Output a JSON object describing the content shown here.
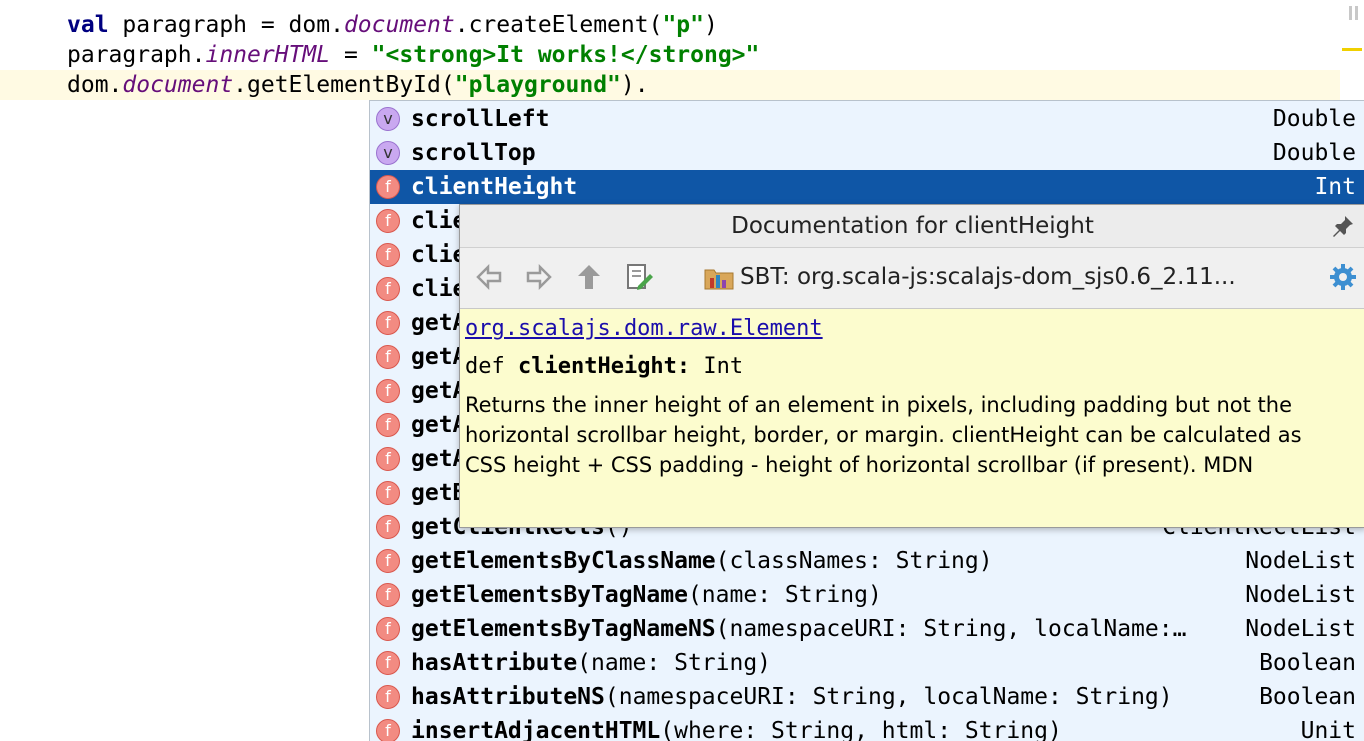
{
  "code": {
    "line1": {
      "kw": "val",
      "a": " paragraph = dom.",
      "it": "document",
      "b": ".createElement(",
      "str": "\"p\"",
      "c": ")"
    },
    "line2": {
      "a": "paragraph.",
      "it": "innerHTML",
      "b": " = ",
      "str": "\"<strong>It works!</strong>\""
    },
    "line3": {
      "a": "dom.",
      "it": "document",
      "b": ".getElementById(",
      "str": "\"playground\"",
      "c": ")."
    }
  },
  "completion": {
    "items": [
      {
        "icon": "v",
        "name": "scrollLeft",
        "sig": "",
        "type": "Double"
      },
      {
        "icon": "v",
        "name": "scrollTop",
        "sig": "",
        "type": "Double"
      },
      {
        "icon": "f",
        "name": "clientHeight",
        "sig": "",
        "type": "Int",
        "selected": true
      },
      {
        "icon": "f",
        "name": "clie",
        "sig": "",
        "type": ""
      },
      {
        "icon": "f",
        "name": "clie",
        "sig": "",
        "type": ""
      },
      {
        "icon": "f",
        "name": "clie",
        "sig": "",
        "type": ""
      },
      {
        "icon": "f",
        "name": "getA",
        "sig": "",
        "type": ""
      },
      {
        "icon": "f",
        "name": "getA",
        "sig": "",
        "type": ""
      },
      {
        "icon": "f",
        "name": "getA",
        "sig": "",
        "type": ""
      },
      {
        "icon": "f",
        "name": "getA",
        "sig": "",
        "type": ""
      },
      {
        "icon": "f",
        "name": "getA",
        "sig": "",
        "type": ""
      },
      {
        "icon": "f",
        "name": "getB",
        "sig": "",
        "type": ""
      },
      {
        "icon": "f",
        "name": "getClientRects",
        "sig": "()",
        "type": "ClientRectList"
      },
      {
        "icon": "f",
        "name": "getElementsByClassName",
        "sig": "(classNames: String)",
        "type": "NodeList"
      },
      {
        "icon": "f",
        "name": "getElementsByTagName",
        "sig": "(name: String)",
        "type": "NodeList"
      },
      {
        "icon": "f",
        "name": "getElementsByTagNameNS",
        "sig": "(namespaceURI: String, localName:…",
        "type": "NodeList"
      },
      {
        "icon": "f",
        "name": "hasAttribute",
        "sig": "(name: String)",
        "type": "Boolean"
      },
      {
        "icon": "f",
        "name": "hasAttributeNS",
        "sig": "(namespaceURI: String, localName: String)",
        "type": "Boolean"
      },
      {
        "icon": "f",
        "name": "insertAdjacentHTML",
        "sig": "(where: String, html: String)",
        "type": "Unit"
      }
    ]
  },
  "doc": {
    "title": "Documentation for clientHeight",
    "source": "SBT: org.scala-js:scalajs-dom_sjs0.6_2.11...",
    "link": "org.scalajs.dom.raw.Element",
    "def_prefix": "def ",
    "def_name": "clientHeight:",
    "def_type": " Int",
    "description": "Returns the inner height of an element in pixels, including padding but not the horizontal scrollbar height, border, or margin. clientHeight can be calculated as CSS height + CSS padding - height of horizontal scrollbar (if present). MDN"
  },
  "colors": {
    "selection": "#0f56a6",
    "popup_bg": "#ebf4fe",
    "doc_bg": "#fcfcce"
  }
}
